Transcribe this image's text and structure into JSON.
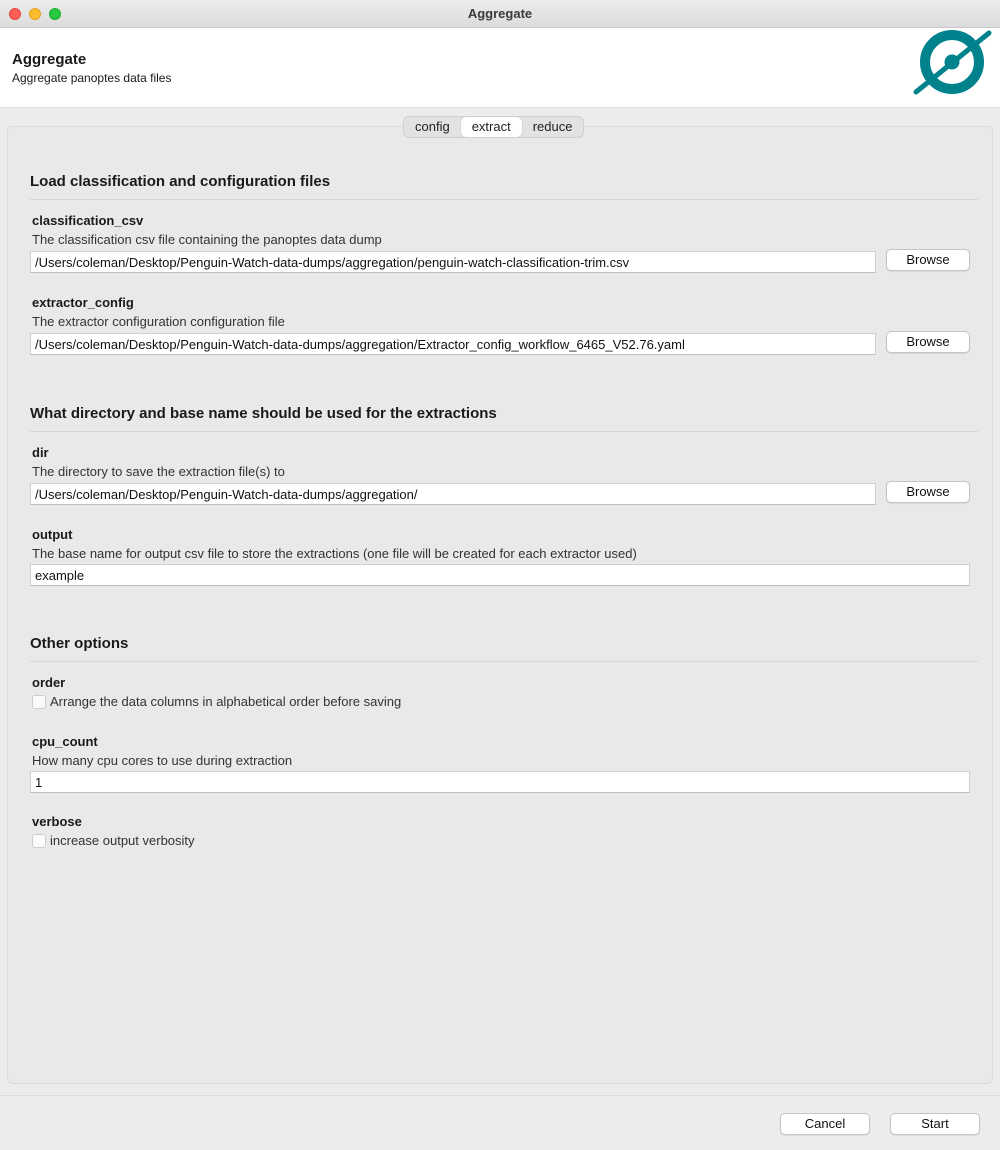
{
  "window": {
    "title": "Aggregate"
  },
  "header": {
    "title": "Aggregate",
    "subtitle": "Aggregate panoptes data files",
    "logo_icon": "panoptes-logo",
    "logo_color": "#00828c"
  },
  "tabs": [
    {
      "label": "config",
      "active": false
    },
    {
      "label": "extract",
      "active": true
    },
    {
      "label": "reduce",
      "active": false
    }
  ],
  "sections": {
    "load": {
      "title": "Load classification and configuration files"
    },
    "dir": {
      "title": "What directory and base name should be used for the extractions"
    },
    "other": {
      "title": "Other options"
    }
  },
  "fields": {
    "classification_csv": {
      "label": "classification_csv",
      "description": "The classification csv file containing the panoptes data dump",
      "value": "/Users/coleman/Desktop/Penguin-Watch-data-dumps/aggregation/penguin-watch-classification-trim.csv",
      "browse_label": "Browse"
    },
    "extractor_config": {
      "label": "extractor_config",
      "description": "The extractor configuration configuration file",
      "value": "/Users/coleman/Desktop/Penguin-Watch-data-dumps/aggregation/Extractor_config_workflow_6465_V52.76.yaml",
      "browse_label": "Browse"
    },
    "dir": {
      "label": "dir",
      "description": "The directory to save the extraction file(s) to",
      "value": "/Users/coleman/Desktop/Penguin-Watch-data-dumps/aggregation/",
      "browse_label": "Browse"
    },
    "output": {
      "label": "output",
      "description": "The base name for output csv file to store the extractions (one file will be created for each extractor used)",
      "value": "example"
    },
    "order": {
      "label": "order",
      "checkbox_label": "Arrange the data columns in alphabetical order before saving",
      "checked": false
    },
    "cpu_count": {
      "label": "cpu_count",
      "description": "How many cpu cores to use during extraction",
      "value": "1"
    },
    "verbose": {
      "label": "verbose",
      "checkbox_label": "increase output verbosity",
      "checked": false
    }
  },
  "footer": {
    "cancel_label": "Cancel",
    "start_label": "Start"
  }
}
